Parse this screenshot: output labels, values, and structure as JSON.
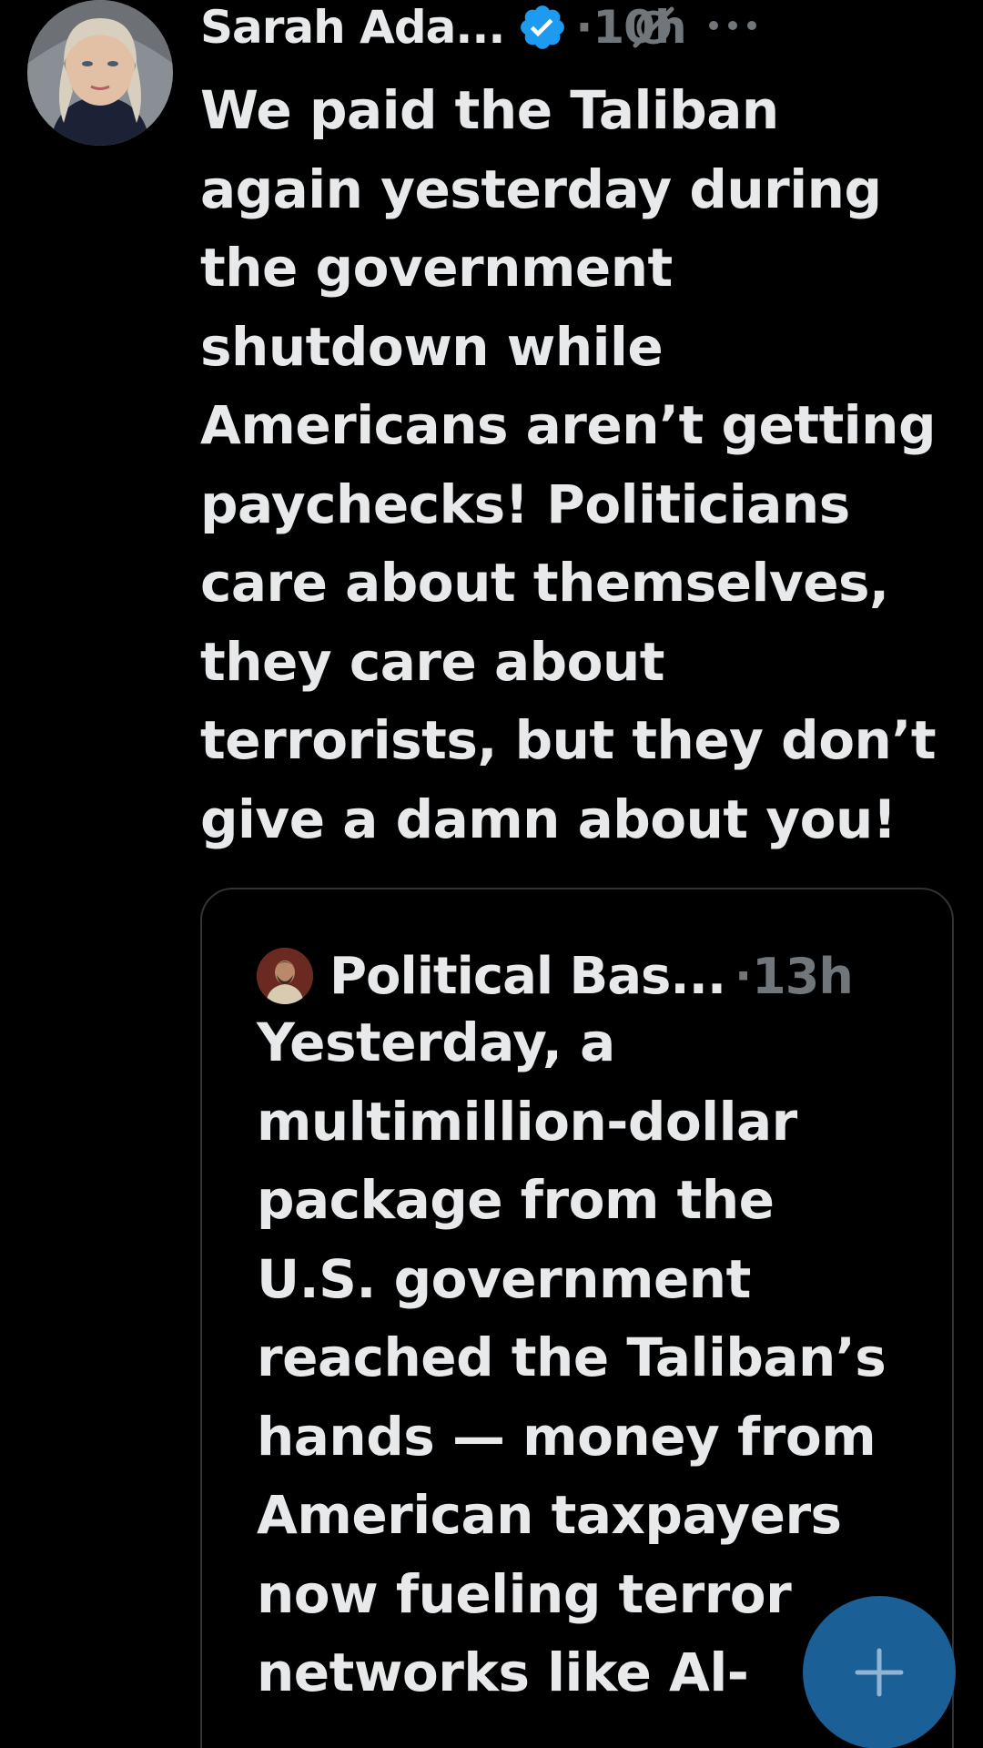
{
  "tweet": {
    "author_name": "Sarah Ada...",
    "separator": "·",
    "time": "10h",
    "text": "We paid the Taliban\nagain yesterday during\nthe government\nshutdown while\nAmericans aren’t getting\npaychecks! Politicians\ncare about themselves,\nthey care about\nterrorists, but they don’t\ngive a damn about you!"
  },
  "quote": {
    "author_name": "Political Bas...",
    "separator": "·",
    "time": "13h",
    "text": "Yesterday, a\nmultimillion-dollar\npackage from the\nU.S. government\nreached the Taliban’s\nhands — money from\nAmerican taxpayers\nnow fueling terror\nnetworks like Al-"
  },
  "colors": {
    "background": "#000000",
    "text": "#e7e9ea",
    "muted": "#71767b",
    "verified": "#1d9bf0",
    "fab": "#1a5f96",
    "border": "#2f3336"
  },
  "icons": {
    "verified": "verified-badge-icon",
    "grok": "grok-icon",
    "more": "more-dots-icon",
    "fab": "plus-icon"
  }
}
